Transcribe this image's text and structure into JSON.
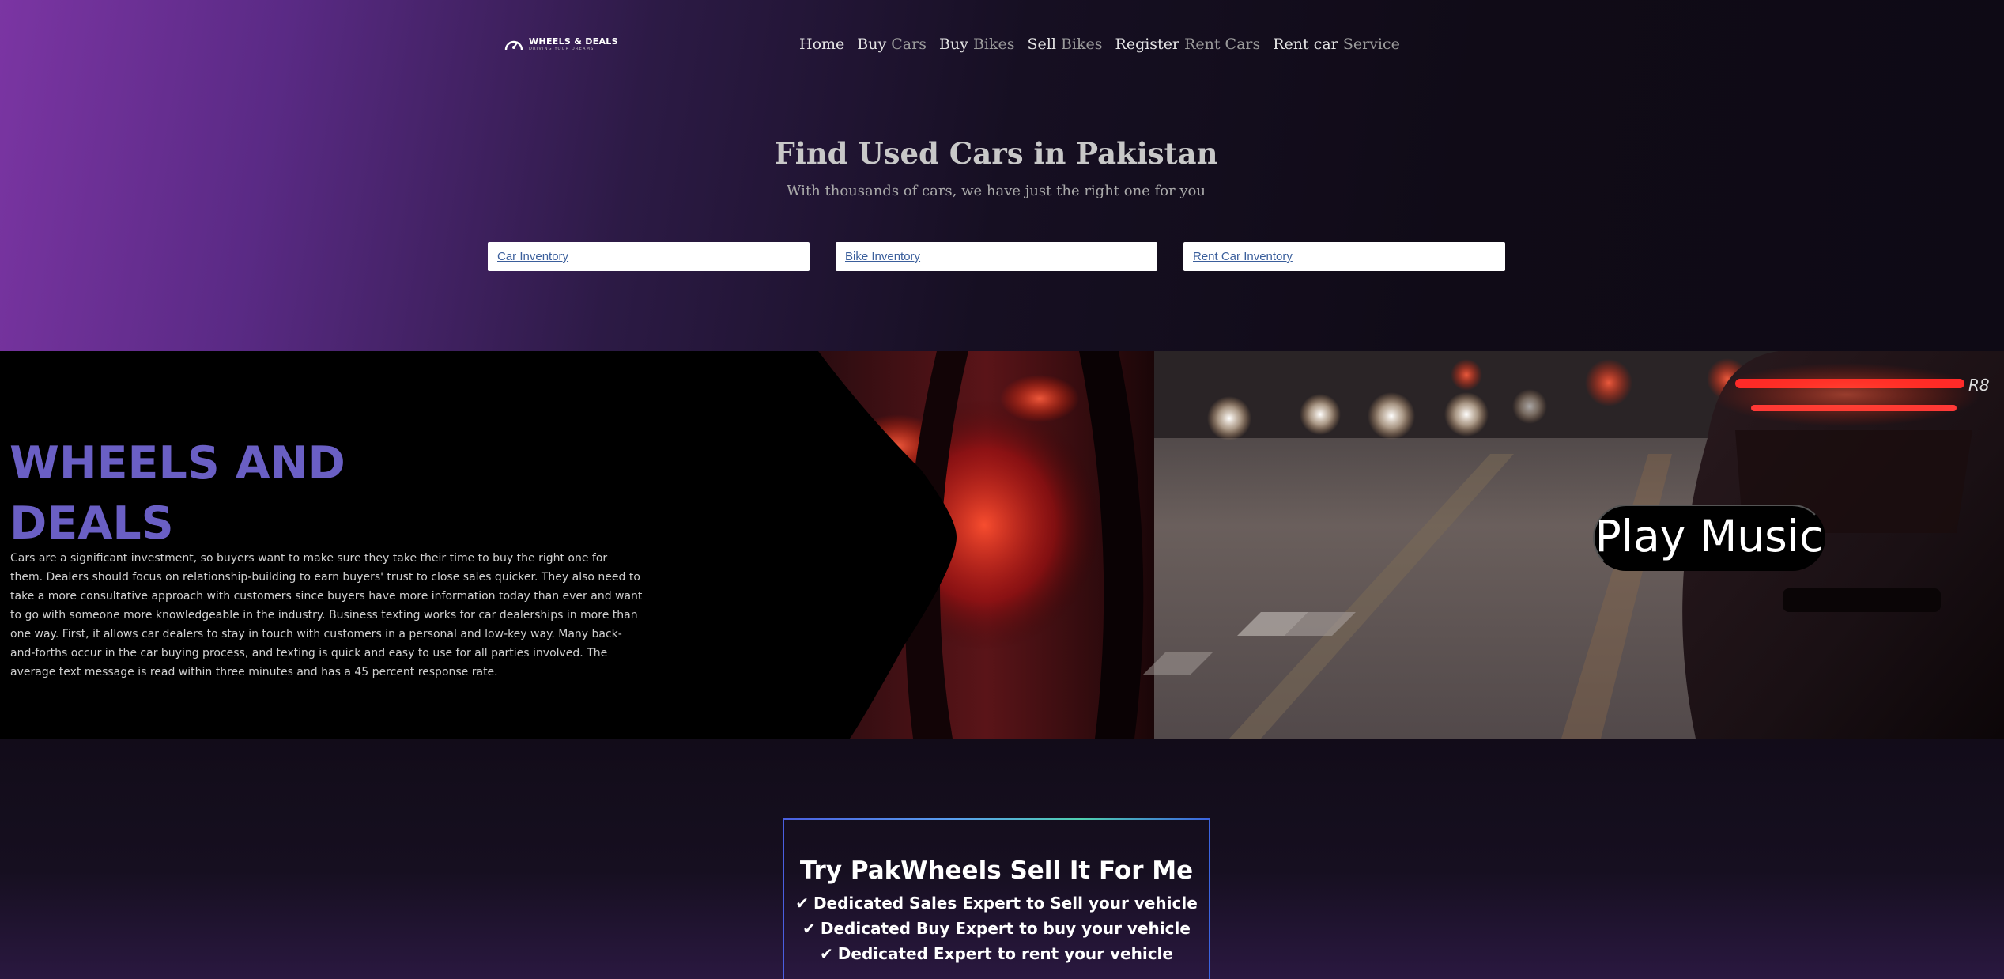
{
  "header": {
    "logo_title": "WHEELS & DEALS",
    "logo_tagline": "DRIVING YOUR DREAMS",
    "nav": [
      {
        "first": "Home",
        "rest": ""
      },
      {
        "first": "Buy",
        "rest": "Cars"
      },
      {
        "first": "Buy",
        "rest": "Bikes"
      },
      {
        "first": "Sell",
        "rest": "Bikes"
      },
      {
        "first": "Register",
        "rest": "Rent Cars"
      },
      {
        "first": "Rent car",
        "rest": "Service"
      }
    ]
  },
  "hero": {
    "title": "Find Used Cars in Pakistan",
    "subtitle": "With thousands of cars, we have just the right one for you",
    "buttons": [
      "Car Inventory",
      "Bike Inventory",
      "Rent Car Inventory"
    ]
  },
  "banner": {
    "title_line1": "WHEELS AND",
    "title_line2": "DEALS",
    "paragraph": "Cars are a significant investment, so buyers want to make sure they take their time to buy the right one for them. Dealers should focus on relationship-building to earn buyers' trust to close sales quicker. They also need to take a more consultative approach with customers since buyers have more information today than ever and want to go with someone more knowledgeable in the industry. Business texting works for car dealerships in more than one way. First, it allows car dealers to stay in touch with customers in a personal and low-key way. Many back-and-forths occur in the car buying process, and texting is quick and easy to use for all parties involved. The average text message is read within three minutes and has a 45 percent response rate.",
    "play_button": "Play Music",
    "badge_text": "R8"
  },
  "sell": {
    "title": "Try PakWheels Sell It For Me",
    "items": [
      "Dedicated Sales Expert to Sell your vehicle",
      "Dedicated Buy Expert to buy your vehicle",
      "Dedicated Expert to rent your vehicle"
    ]
  },
  "colors": {
    "brand_purple": "#6a5fc4",
    "hero_gradient_start": "#7b35a3",
    "link_blue": "#3b5f9c",
    "taillight_red": "#ff2a2a"
  }
}
